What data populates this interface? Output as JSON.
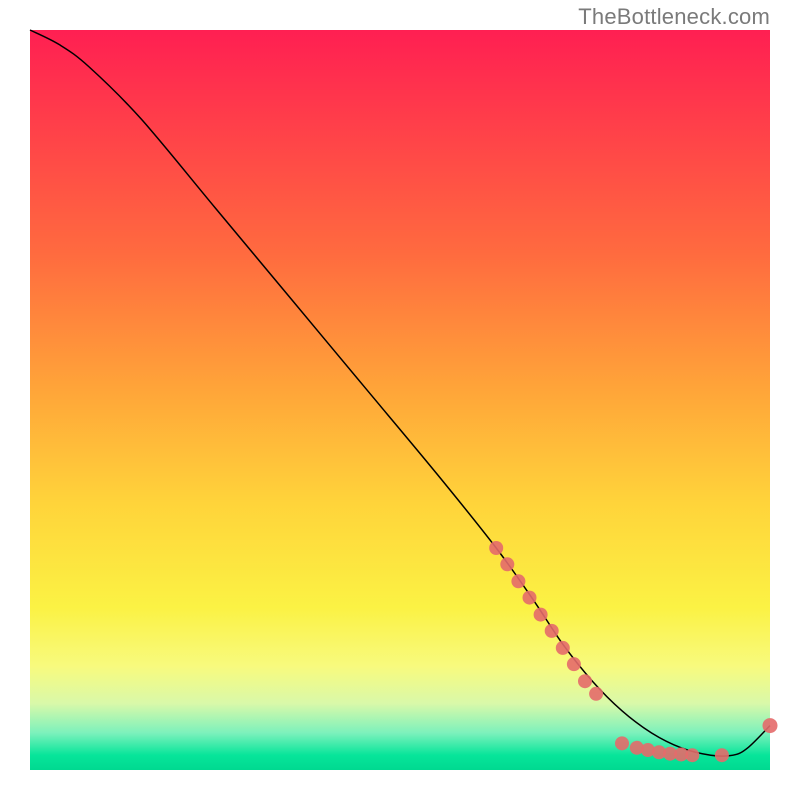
{
  "attribution": {
    "text": "TheBottleneck.com"
  },
  "chart_data": {
    "type": "line",
    "title": "",
    "xlabel": "",
    "ylabel": "",
    "xlim": [
      0,
      100
    ],
    "ylim": [
      0,
      100
    ],
    "grid": false,
    "legend": false,
    "annotation": "TheBottleneck.com",
    "series": [
      {
        "name": "bottleneck-curve",
        "x": [
          0,
          4,
          8,
          15,
          25,
          35,
          45,
          55,
          63,
          68,
          72,
          76,
          80,
          84,
          88,
          92,
          95,
          97,
          100
        ],
        "y": [
          100,
          98,
          95,
          88,
          76,
          64,
          52,
          40,
          30,
          23,
          17,
          12,
          8,
          5,
          3,
          2,
          2,
          3,
          6
        ]
      }
    ],
    "marker_clusters": [
      {
        "name": "steep-segment-dots",
        "x": [
          63,
          64.5,
          66,
          67.5,
          69,
          70.5,
          72,
          73.5,
          75,
          76.5
        ],
        "y": [
          30,
          27.8,
          25.5,
          23.3,
          21,
          18.8,
          16.5,
          14.3,
          12,
          10.3
        ]
      },
      {
        "name": "trough-segment-dots",
        "x": [
          80,
          82,
          83.5,
          85,
          86.5,
          88,
          89.5,
          93.5
        ],
        "y": [
          3.6,
          3.0,
          2.7,
          2.4,
          2.2,
          2.1,
          2.0,
          2.0
        ]
      },
      {
        "name": "end-dot",
        "x": [
          100
        ],
        "y": [
          6
        ]
      }
    ]
  }
}
